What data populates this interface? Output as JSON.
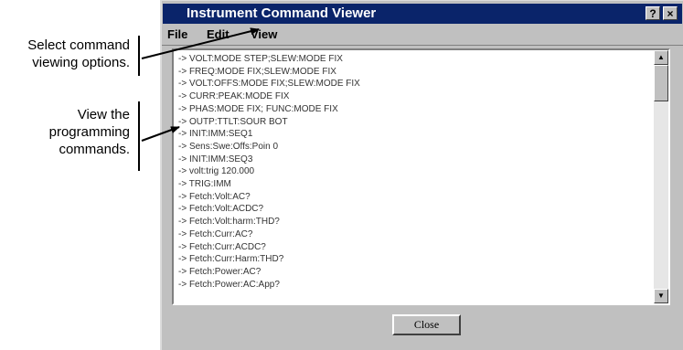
{
  "callouts": [
    "Select command viewing options.",
    "View the programming commands."
  ],
  "window": {
    "title": "Instrument Command Viewer",
    "help_label": "?",
    "close_label": "×"
  },
  "menu": {
    "file": "File",
    "edit": "Edit",
    "view": "View"
  },
  "commands": [
    "-> VOLT:MODE STEP;SLEW:MODE FIX",
    "-> FREQ:MODE FIX;SLEW:MODE FIX",
    "-> VOLT:OFFS:MODE FIX;SLEW:MODE FIX",
    "-> CURR:PEAK:MODE FIX",
    "-> PHAS:MODE FIX; FUNC:MODE FIX",
    "-> OUTP:TTLT:SOUR BOT",
    "-> INIT:IMM:SEQ1",
    "-> Sens:Swe:Offs:Poin 0",
    "-> INIT:IMM:SEQ3",
    "-> volt:trig  120.000",
    "-> TRIG:IMM",
    "-> Fetch:Volt:AC?",
    "-> Fetch:Volt:ACDC?",
    "-> Fetch:Volt:harm:THD?",
    "-> Fetch:Curr:AC?",
    "-> Fetch:Curr:ACDC?",
    "-> Fetch:Curr:Harm:THD?",
    "-> Fetch:Power:AC?",
    "-> Fetch:Power:AC:App?"
  ],
  "close_button": "Close",
  "colors": {
    "titlebar": "#0a246a",
    "window_face": "#c0c0c0"
  }
}
